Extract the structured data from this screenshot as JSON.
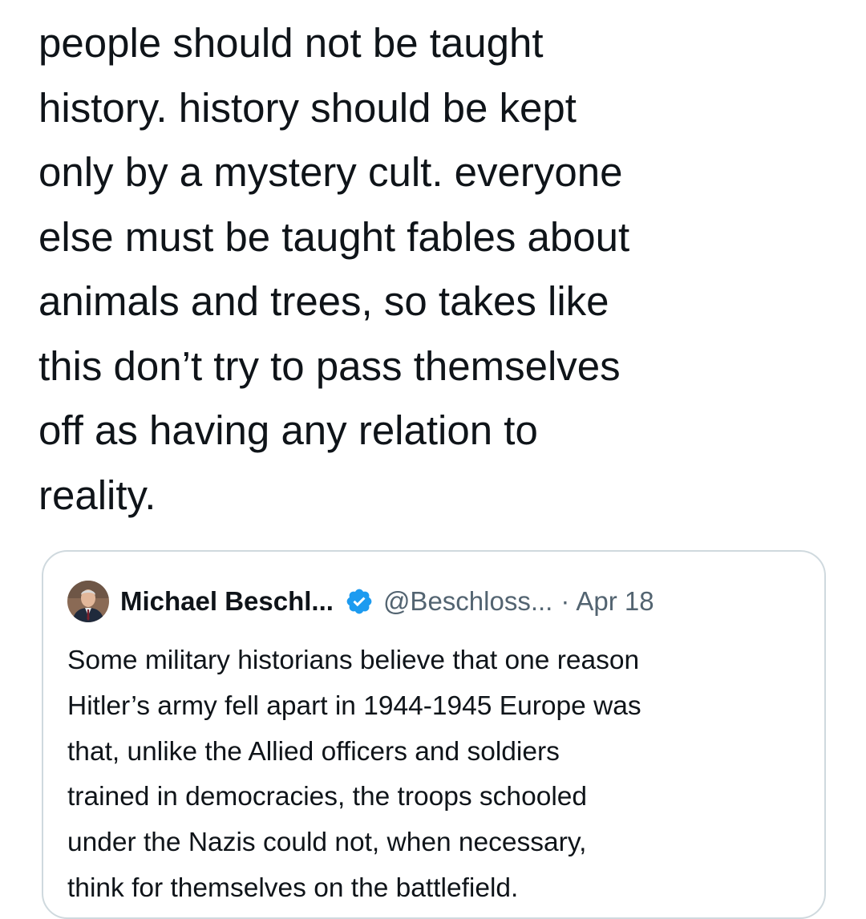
{
  "tweet": {
    "text": "people should not be taught\nhistory. history should be kept\nonly by a mystery cult. everyone\nelse must be taught fables about\nanimals and trees, so takes like\nthis don’t try to pass themselves\noff as having any relation to\nreality."
  },
  "quoted_tweet": {
    "author_name": "Michael Beschl...",
    "handle": "@Beschloss...",
    "separator": "·",
    "date": "Apr 18",
    "verified_badge_icon": "verified-check-icon",
    "verified_color": "#1d9bf0",
    "avatar_icon": "profile-photo",
    "text": "Some military historians believe that one reason\nHitler’s army fell apart in 1944-1945 Europe was\nthat, unlike the Allied officers and soldiers\ntrained in democracies, the troops schooled\nunder the Nazis could not, when necessary,\nthink for themselves on the battlefield."
  },
  "colors": {
    "text_primary": "#0f1419",
    "text_secondary": "#536471",
    "card_border": "#cfd9de",
    "background": "#ffffff"
  }
}
